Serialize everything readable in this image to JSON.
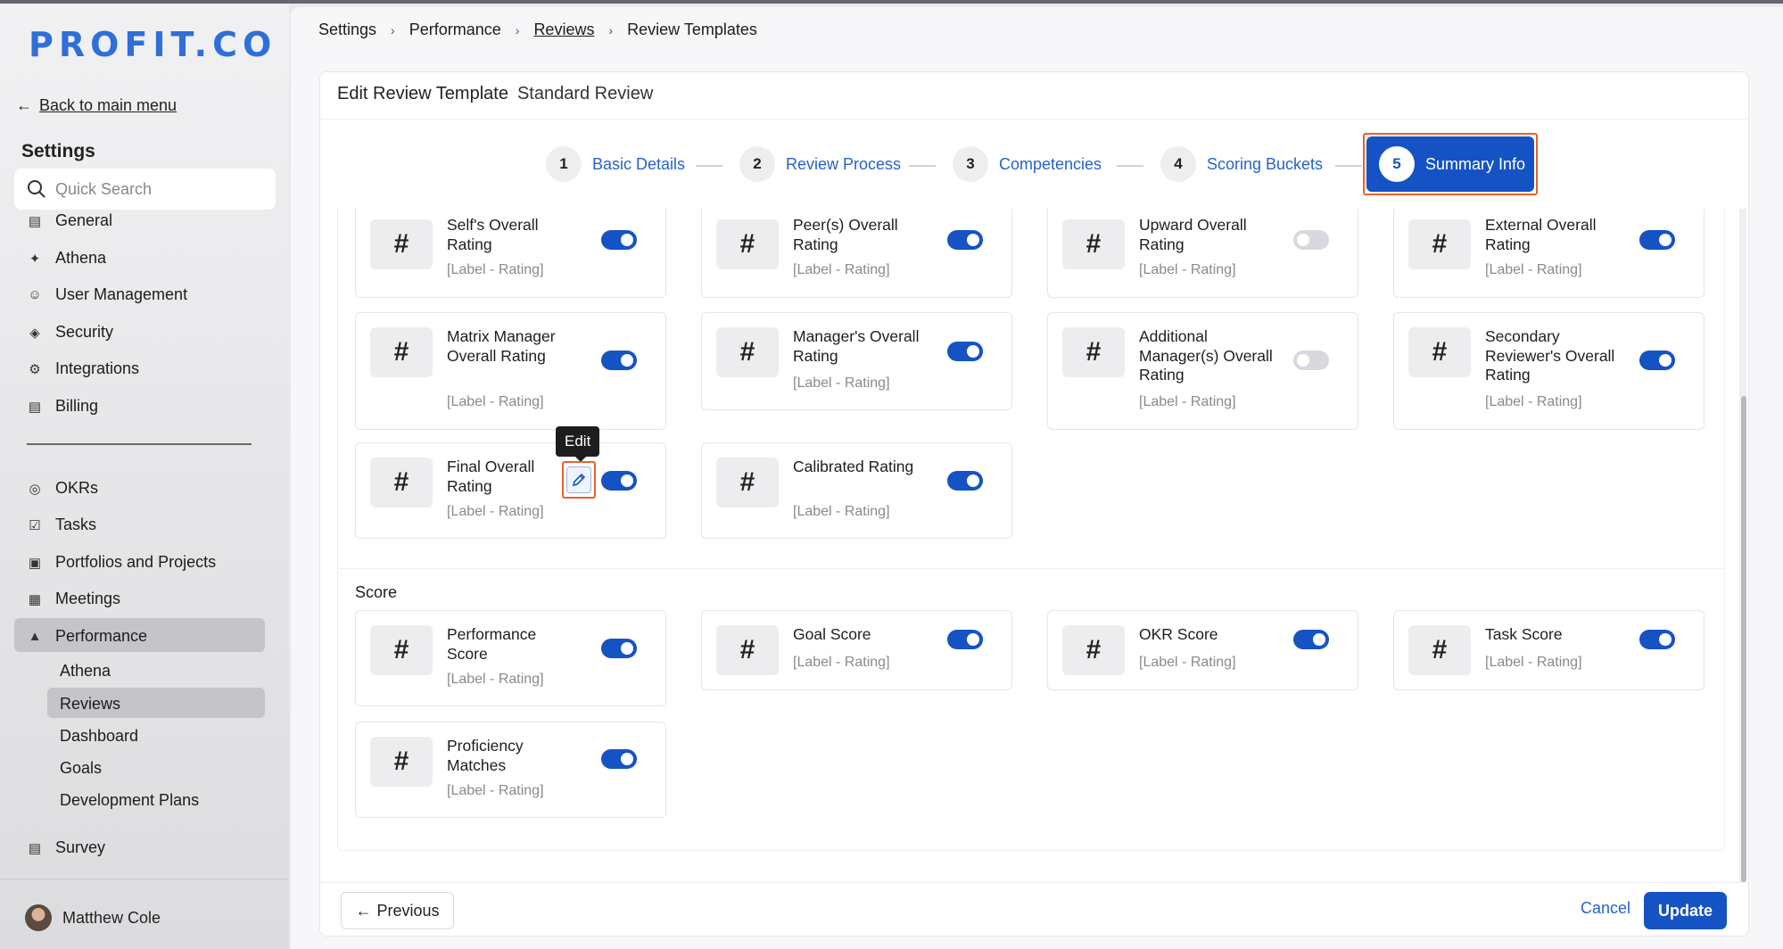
{
  "brand": {
    "logo_text": "PROFIT.CO",
    "accent": "#1553c4",
    "link_color": "#2563c9",
    "highlight": "#e8622c"
  },
  "sidebar": {
    "back_label": "Back to main menu",
    "title": "Settings",
    "search_placeholder": "Quick Search",
    "items": [
      {
        "label": "General",
        "icon": "monitor-icon"
      },
      {
        "label": "Athena",
        "icon": "sparkle-icon"
      },
      {
        "label": "User Management",
        "icon": "user-icon"
      },
      {
        "label": "Security",
        "icon": "shield-icon"
      },
      {
        "label": "Integrations",
        "icon": "gear-icon"
      },
      {
        "label": "Billing",
        "icon": "receipt-icon"
      },
      {
        "label": "OKRs",
        "icon": "target-icon"
      },
      {
        "label": "Tasks",
        "icon": "checkbox-icon"
      },
      {
        "label": "Portfolios and Projects",
        "icon": "briefcase-icon"
      },
      {
        "label": "Meetings",
        "icon": "calendar-icon"
      },
      {
        "label": "Performance",
        "icon": "chart-icon"
      },
      {
        "label": "Survey",
        "icon": "survey-icon"
      }
    ],
    "performance_sub": [
      "Athena",
      "Reviews",
      "Dashboard",
      "Goals",
      "Development Plans"
    ],
    "user_name": "Matthew Cole"
  },
  "breadcrumb": [
    "Settings",
    "Performance",
    "Reviews",
    "Review Templates"
  ],
  "page": {
    "title": "Edit Review Template",
    "template_name": "Standard Review"
  },
  "steps": [
    {
      "num": "1",
      "label": "Basic Details"
    },
    {
      "num": "2",
      "label": "Review Process"
    },
    {
      "num": "3",
      "label": "Competencies"
    },
    {
      "num": "4",
      "label": "Scoring Buckets"
    },
    {
      "num": "5",
      "label": "Summary Info"
    }
  ],
  "tiles": [
    {
      "label": "Self's Overall Rating",
      "sub": "[Label - Rating]",
      "on": true
    },
    {
      "label": "Peer(s) Overall Rating",
      "sub": "[Label - Rating]",
      "on": true
    },
    {
      "label": "Upward Overall Rating",
      "sub": "[Label - Rating]",
      "on": false
    },
    {
      "label": "External Overall Rating",
      "sub": "[Label - Rating]",
      "on": true
    },
    {
      "label": "Matrix Manager Overall Rating",
      "sub": "[Label - Rating]",
      "on": true
    },
    {
      "label": "Manager's Overall Rating",
      "sub": "[Label - Rating]",
      "on": true
    },
    {
      "label": "Additional Manager(s) Overall Rating",
      "sub": "[Label - Rating]",
      "on": false
    },
    {
      "label": "Secondary Reviewer's Overall Rating",
      "sub": "[Label - Rating]",
      "on": true
    },
    {
      "label": "Final Overall Rating",
      "sub": "[Label - Rating]",
      "on": true
    },
    {
      "label": "Calibrated Rating",
      "sub": "[Label - Rating]",
      "on": true
    }
  ],
  "score_section": {
    "title": "Score",
    "tiles": [
      {
        "label": "Performance Score",
        "sub": "[Label - Rating]",
        "on": true
      },
      {
        "label": "Goal Score",
        "sub": "[Label - Rating]",
        "on": true
      },
      {
        "label": "OKR Score",
        "sub": "[Label - Rating]",
        "on": true
      },
      {
        "label": "Task Score",
        "sub": "[Label - Rating]",
        "on": true
      },
      {
        "label": "Proficiency Matches",
        "sub": "[Label - Rating]",
        "on": true
      }
    ]
  },
  "tooltip": "Edit",
  "tile_symbol": "#",
  "footer": {
    "previous": "Previous",
    "cancel": "Cancel",
    "update": "Update"
  }
}
